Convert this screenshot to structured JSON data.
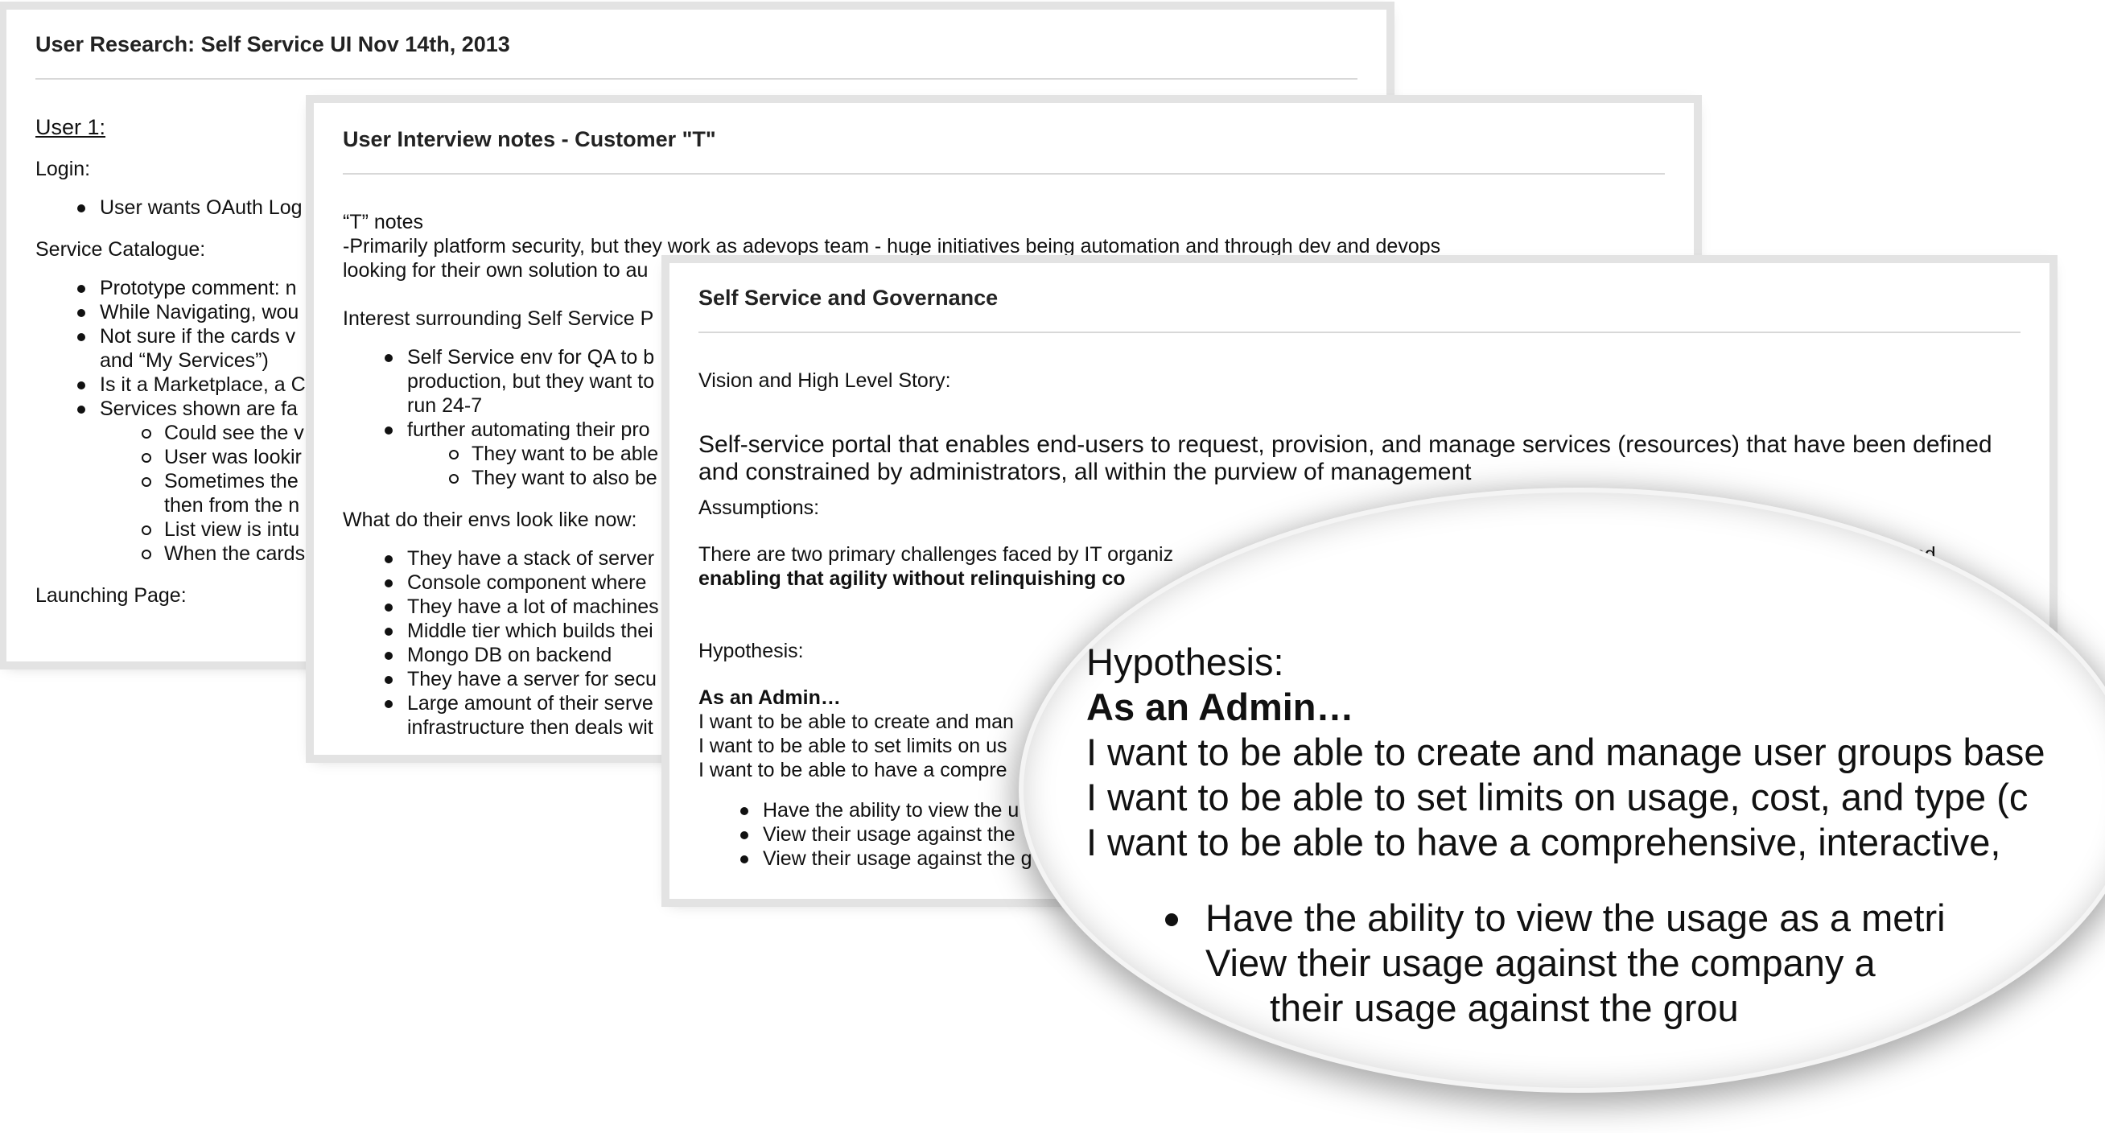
{
  "doc1": {
    "title": "User Research: Self Service UI Nov 14th, 2013",
    "user_heading": "User 1:",
    "login_label": "Login:",
    "login_items": [
      "User wants OAuth Log"
    ],
    "catalogue_label": "Service Catalogue:",
    "catalogue_items": [
      "Prototype comment: n",
      "While Navigating, wou",
      "Not sure if the cards v",
      "and “My Services”)",
      "Is it a Marketplace, a C",
      "Services shown are fa"
    ],
    "catalogue_subitems": [
      "Could see the v",
      "User was lookir",
      "Sometimes the",
      "then from the n",
      "List view is intu",
      "When the cards"
    ],
    "launching_label": "Launching Page:"
  },
  "doc2": {
    "title": "User Interview notes - Customer \"T\"",
    "notes_label": "“T” notes",
    "notes_line1": "-Primarily platform security, but they work as adevops team - huge initiatives being automation and through dev and devops",
    "notes_line2": "looking for their own solution to au",
    "interest_label": "Interest surrounding Self Service P",
    "interest_items": [
      "Self Service env for QA to b",
      "production, but they want to",
      "run 24-7",
      "further automating their pro"
    ],
    "interest_subitems": [
      "They want to be able",
      "They want to also be"
    ],
    "envs_label": "What do their envs look like now:",
    "envs_items": [
      "They have a stack of server",
      "Console component where",
      "They have a lot of machines",
      "Middle tier which builds thei",
      "Mongo DB on backend",
      "They have a server for secu",
      "Large amount of their serve",
      "infrastructure then deals wit"
    ]
  },
  "doc3": {
    "title": "Self Service and Governance",
    "vision_label": "Vision and High Level Story:",
    "vision_line1": "Self-service portal that enables end-users to request, provision, and manage services (resources) that have been defined",
    "vision_line2": "and constrained by administrators, all within the purview of management",
    "assumptions_label": "Assumptions:",
    "assumptions_line1": "There are two primary challenges faced by IT organiz",
    "assumptions_line1_end": "and",
    "assumptions_line2": "enabling that agility without relinquishing co",
    "hypothesis_label": "Hypothesis:",
    "admin_label": "As an Admin…",
    "admin_lines": [
      "I want to be able to create and man",
      "I want to be able to set limits on us",
      "I want to be able to have a compre"
    ],
    "admin_items": [
      "Have the ability to view the u",
      "View their usage against the",
      "View their usage against the g"
    ]
  },
  "magnifier": {
    "hypothesis_label": "Hypothesis:",
    "admin_label": "As an Admin…",
    "admin_lines": [
      "I want to be able to create and manage user groups base",
      "I want to be able to set limits on usage, cost, and type (c",
      "I want to be able to have a comprehensive, interactive,"
    ],
    "items": [
      "Have the ability to view the usage as a metri",
      "View their usage against the company a",
      "their usage against the grou"
    ]
  }
}
